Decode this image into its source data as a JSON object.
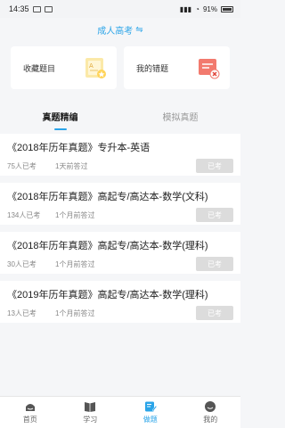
{
  "status": {
    "time": "14:35",
    "battery": "91%"
  },
  "header": {
    "title": "成人高考",
    "swap_symbol": "⇋"
  },
  "cards": [
    {
      "label": "收藏题目",
      "icon": "favorites-book-icon"
    },
    {
      "label": "我的错题",
      "icon": "wrong-questions-icon"
    }
  ],
  "tabs": [
    {
      "label": "真题精编",
      "active": true
    },
    {
      "label": "模拟真题",
      "active": false
    }
  ],
  "items": [
    {
      "title": "《2018年历年真题》专升本-英语",
      "taken": "75人已考",
      "time": "1天前答过",
      "button": "已考"
    },
    {
      "title": "《2018年历年真题》高起专/高达本-数学(文科)",
      "taken": "134人已考",
      "time": "1个月前答过",
      "button": "已考"
    },
    {
      "title": "《2018年历年真题》高起专/高达本-数学(理科)",
      "taken": "30人已考",
      "time": "1个月前答过",
      "button": "已考"
    },
    {
      "title": "《2019年历年真题》高起专/高达本-数学(理科)",
      "taken": "13人已考",
      "time": "1个月前答过",
      "button": "已考"
    }
  ],
  "nav": [
    {
      "label": "首页",
      "icon": "home-icon",
      "active": false
    },
    {
      "label": "学习",
      "icon": "book-icon",
      "active": false
    },
    {
      "label": "做题",
      "icon": "edit-icon",
      "active": true
    },
    {
      "label": "我的",
      "icon": "profile-icon",
      "active": false
    }
  ],
  "colors": {
    "accent": "#2aa4e8",
    "disabled": "#dcdcdc"
  }
}
